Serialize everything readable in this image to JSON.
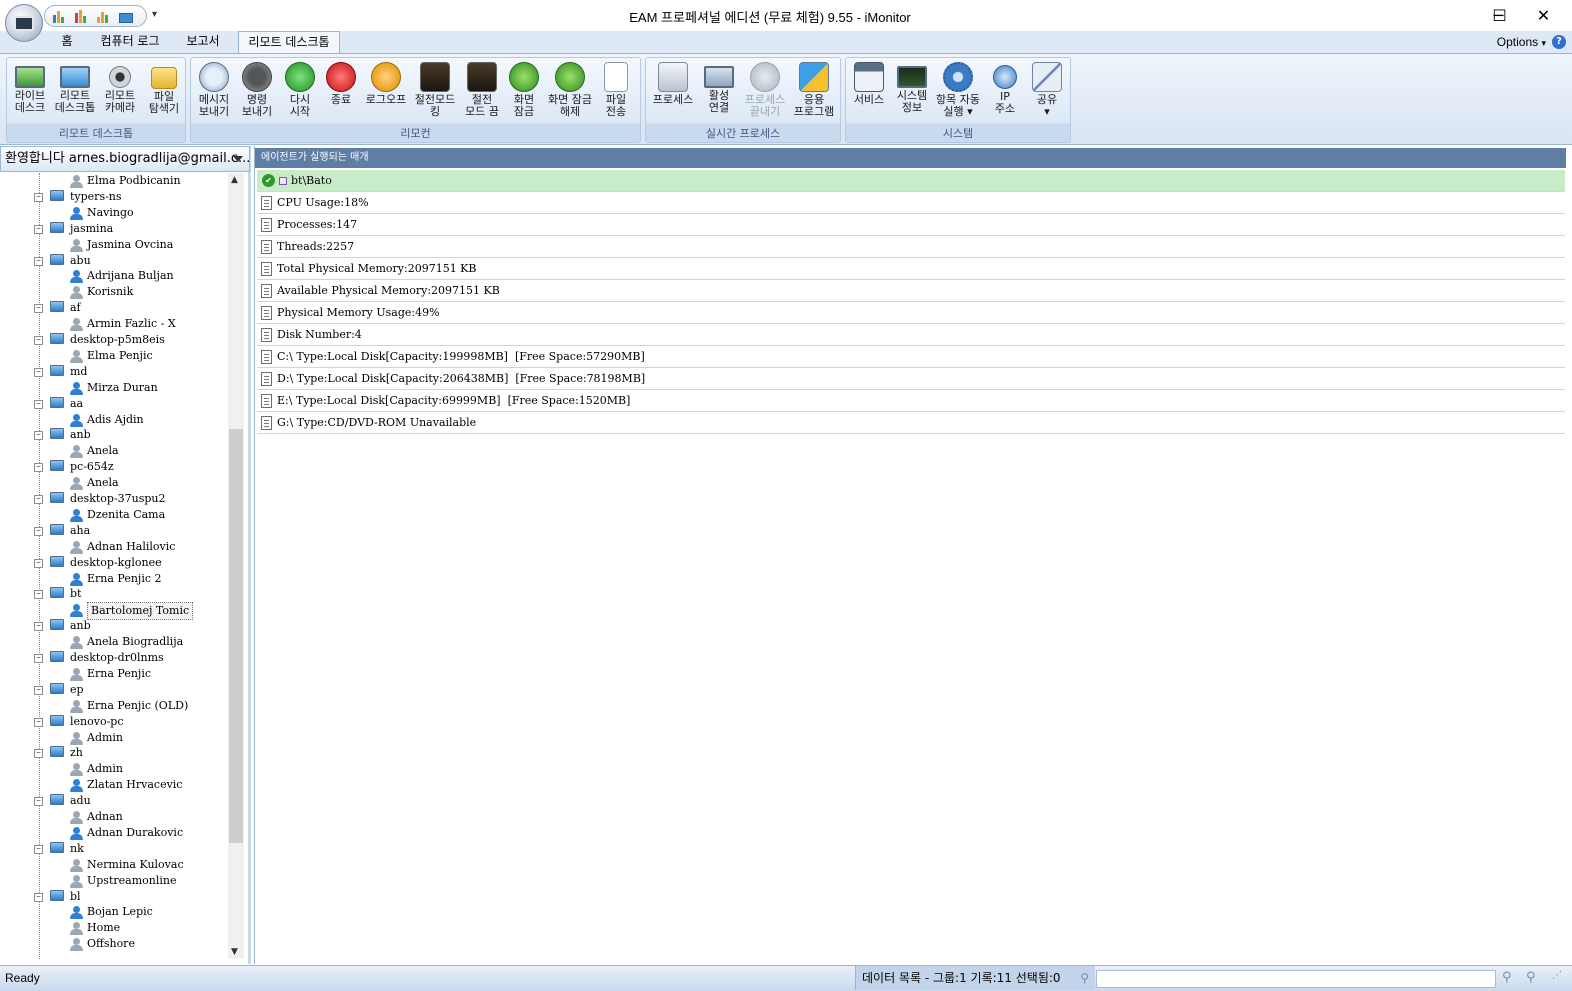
{
  "window": {
    "title": "EAM 프로페셔널 에디션 (무료 체험) 9.55 - iMonitor",
    "minimize_glyph": "─",
    "maximize_glyph": "☐",
    "close_glyph": "✕",
    "qat_more_glyph": "▾"
  },
  "ribbon": {
    "tabs": [
      "홈",
      "컴퓨터 로그",
      "보고서",
      "리모트 데스크톱"
    ],
    "active_tab": "리모트 데스크톱",
    "options_label": "Options",
    "options_caret": "▾",
    "help_glyph": "?",
    "groups": [
      {
        "label": "리모트 데스크톱",
        "buttons": [
          "라이브\n데스크",
          "리모트\n데스크톱",
          "리모트\n카메라",
          "파일\n탐색기"
        ]
      },
      {
        "label": "리모컨",
        "buttons": [
          "메시지\n보내기",
          "명령\n보내기",
          "다시\n시작",
          "종료",
          "로그오프",
          "절전모드\n킹",
          "절전\n모드 끔",
          "화면\n잠금",
          "화면 잠금\n해제",
          "파일\n전송"
        ]
      },
      {
        "label": "실시간 프로세스",
        "buttons": [
          "프로세스",
          "활성\n연결",
          "프로세스\n끝내기",
          "응용\n프로그램"
        ]
      },
      {
        "label": "시스템",
        "buttons": [
          "서비스",
          "시스템\n정보",
          "항목 자동\n실행 ▾",
          "IP\n주소",
          "공유\n▾"
        ]
      }
    ],
    "disabled_buttons": [
      "프로세스\n끝내기"
    ],
    "icons": {
      "remote_desktop": [
        "monitor-icon",
        "remote-desktop-icon",
        "webcam-icon",
        "folder-search-icon"
      ],
      "remote_control": [
        "message-icon",
        "command-icon",
        "restart-icon",
        "shutdown-icon",
        "logoff-icon",
        "sleep-icon",
        "wake-icon",
        "lock-screen-icon",
        "unlock-screen-icon",
        "file-transfer-icon"
      ],
      "realtime_process": [
        "process-icon",
        "connections-icon",
        "kill-process-icon",
        "applications-icon"
      ],
      "system": [
        "services-icon",
        "system-info-icon",
        "autorun-icon",
        "ip-address-icon",
        "share-icon"
      ]
    }
  },
  "left_panel": {
    "welcome_text": "환영합니다 arnes.biogradlija@gmail.c...",
    "tree": [
      {
        "type": "user",
        "label": "Elma Podbicanin",
        "online": false
      },
      {
        "type": "computer",
        "label": "typers-ns"
      },
      {
        "type": "user",
        "label": "Navingo",
        "online": true
      },
      {
        "type": "computer",
        "label": "jasmina"
      },
      {
        "type": "user",
        "label": "Jasmina Ovcina",
        "online": false
      },
      {
        "type": "computer",
        "label": "abu"
      },
      {
        "type": "user",
        "label": "Adrijana Buljan",
        "online": true
      },
      {
        "type": "user",
        "label": "Korisnik",
        "online": false
      },
      {
        "type": "computer",
        "label": "af"
      },
      {
        "type": "user",
        "label": "Armin Fazlic - X",
        "online": false
      },
      {
        "type": "computer",
        "label": "desktop-p5m8eis"
      },
      {
        "type": "user",
        "label": "Elma Penjic",
        "online": false
      },
      {
        "type": "computer",
        "label": "md"
      },
      {
        "type": "user",
        "label": "Mirza Duran",
        "online": true
      },
      {
        "type": "computer",
        "label": "aa"
      },
      {
        "type": "user",
        "label": "Adis Ajdin",
        "online": true
      },
      {
        "type": "computer",
        "label": "anb"
      },
      {
        "type": "user",
        "label": "Anela",
        "online": false
      },
      {
        "type": "computer",
        "label": "pc-654z"
      },
      {
        "type": "user",
        "label": "Anela",
        "online": false
      },
      {
        "type": "computer",
        "label": "desktop-37uspu2"
      },
      {
        "type": "user",
        "label": "Dzenita Cama",
        "online": true
      },
      {
        "type": "computer",
        "label": "aha"
      },
      {
        "type": "user",
        "label": "Adnan Halilovic",
        "online": false
      },
      {
        "type": "computer",
        "label": "desktop-kglonee"
      },
      {
        "type": "user",
        "label": "Erna Penjic 2",
        "online": true
      },
      {
        "type": "computer",
        "label": "bt"
      },
      {
        "type": "user",
        "label": "Bartolomej Tomic",
        "online": true,
        "selected": true
      },
      {
        "type": "computer",
        "label": "anb"
      },
      {
        "type": "user",
        "label": "Anela Biogradlija",
        "online": false
      },
      {
        "type": "computer",
        "label": "desktop-dr0lnms"
      },
      {
        "type": "user",
        "label": "Erna Penjic",
        "online": false
      },
      {
        "type": "computer",
        "label": "ep"
      },
      {
        "type": "user",
        "label": "Erna Penjic (OLD)",
        "online": false
      },
      {
        "type": "computer",
        "label": "lenovo-pc"
      },
      {
        "type": "user",
        "label": "Admin",
        "online": false
      },
      {
        "type": "computer",
        "label": "zh"
      },
      {
        "type": "user",
        "label": "Admin",
        "online": false
      },
      {
        "type": "user",
        "label": "Zlatan Hrvacevic",
        "online": true
      },
      {
        "type": "computer",
        "label": "adu"
      },
      {
        "type": "user",
        "label": "Adnan",
        "online": false
      },
      {
        "type": "user",
        "label": "Adnan Durakovic",
        "online": true
      },
      {
        "type": "computer",
        "label": "nk"
      },
      {
        "type": "user",
        "label": "Nermina Kulovac",
        "online": false
      },
      {
        "type": "user",
        "label": "Upstreamonline",
        "online": false
      },
      {
        "type": "computer",
        "label": "bl"
      },
      {
        "type": "user",
        "label": "Bojan Lepic",
        "online": true
      },
      {
        "type": "user",
        "label": "Home",
        "online": false
      },
      {
        "type": "user",
        "label": "Offshore",
        "online": false
      }
    ],
    "scroll_up": "▲",
    "scroll_down": "▼"
  },
  "right_panel": {
    "header": "에이전트가 실행되는 매개",
    "selected_row": "bt\\Bato",
    "rows": [
      "CPU Usage:18%",
      "Processes:147",
      "Threads:2257",
      "Total Physical Memory:2097151 KB",
      "Available Physical Memory:2097151 KB",
      "Physical Memory Usage:49%",
      "Disk Number:4",
      "C:\\ Type:Local Disk[Capacity:199998MB]  [Free Space:57290MB]",
      "D:\\ Type:Local Disk[Capacity:206438MB]  [Free Space:78198MB]",
      "E:\\ Type:Local Disk[Capacity:69999MB]  [Free Space:1520MB]",
      "G:\\ Type:CD/DVD-ROM Unavailable"
    ]
  },
  "status_bar": {
    "ready": "Ready",
    "info": "데이터 목록 - 그룹:1 기록:11 선택됨:0",
    "search_placeholder": ""
  },
  "colors": {
    "online_user": "#2e7fd6",
    "offline_user": "#9aa7b6",
    "selected_row_bg": "#c8ebc8",
    "header_bg": "#5f7ea6"
  }
}
